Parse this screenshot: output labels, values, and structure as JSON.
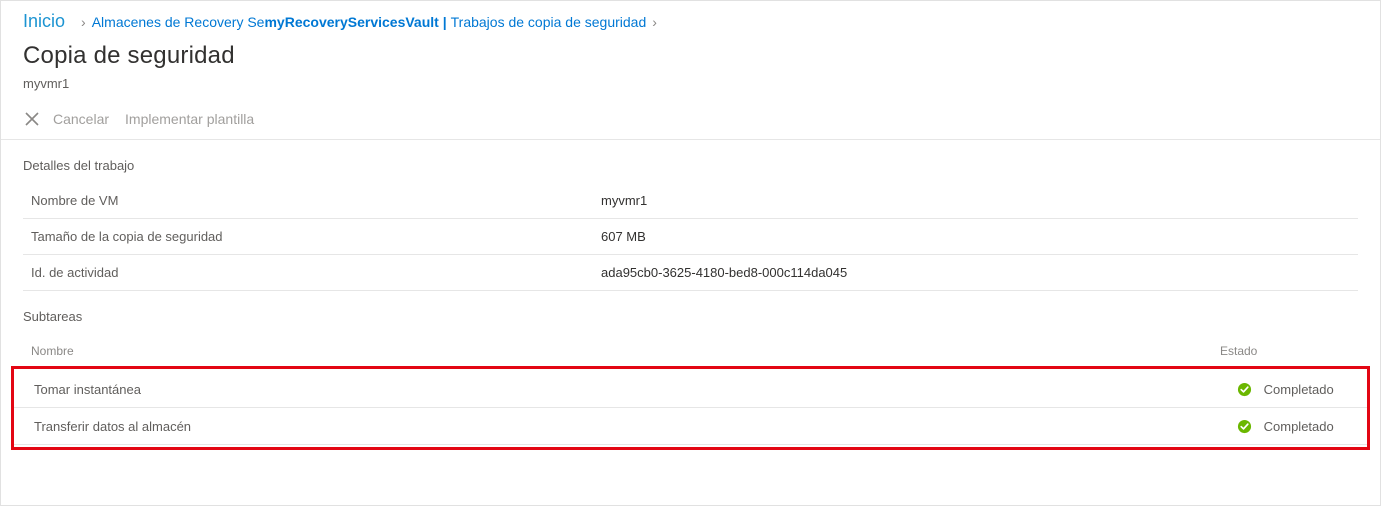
{
  "breadcrumb": {
    "home": "Inicio",
    "item1": "Almacenes de Recovery Se",
    "item2": "myRecoveryServicesVault |",
    "item3": "Trabajos de copia de seguridad"
  },
  "page": {
    "title": "Copia de seguridad",
    "subtitle": "myvmr1"
  },
  "toolbar": {
    "cancel": "Cancelar",
    "deploy": "Implementar plantilla"
  },
  "sections": {
    "details_title": "Detalles del trabajo",
    "subtasks_title": "Subtareas"
  },
  "details": {
    "rows": [
      {
        "label": "Nombre de VM",
        "value": "myvmr1"
      },
      {
        "label": "Tamaño de la copia de seguridad",
        "value": "607 MB"
      },
      {
        "label": "Id. de actividad",
        "value": "ada95cb0-3625-4180-bed8-000c114da045"
      }
    ]
  },
  "subtasks": {
    "columns": {
      "name": "Nombre",
      "status": "Estado"
    },
    "rows": [
      {
        "name": "Tomar instantánea",
        "status": "Completado",
        "status_icon": "success"
      },
      {
        "name": "Transferir datos al almacén",
        "status": "Completado",
        "status_icon": "success"
      }
    ]
  },
  "colors": {
    "link": "#0078d4",
    "success": "#6bb700",
    "highlight": "#e30613"
  }
}
